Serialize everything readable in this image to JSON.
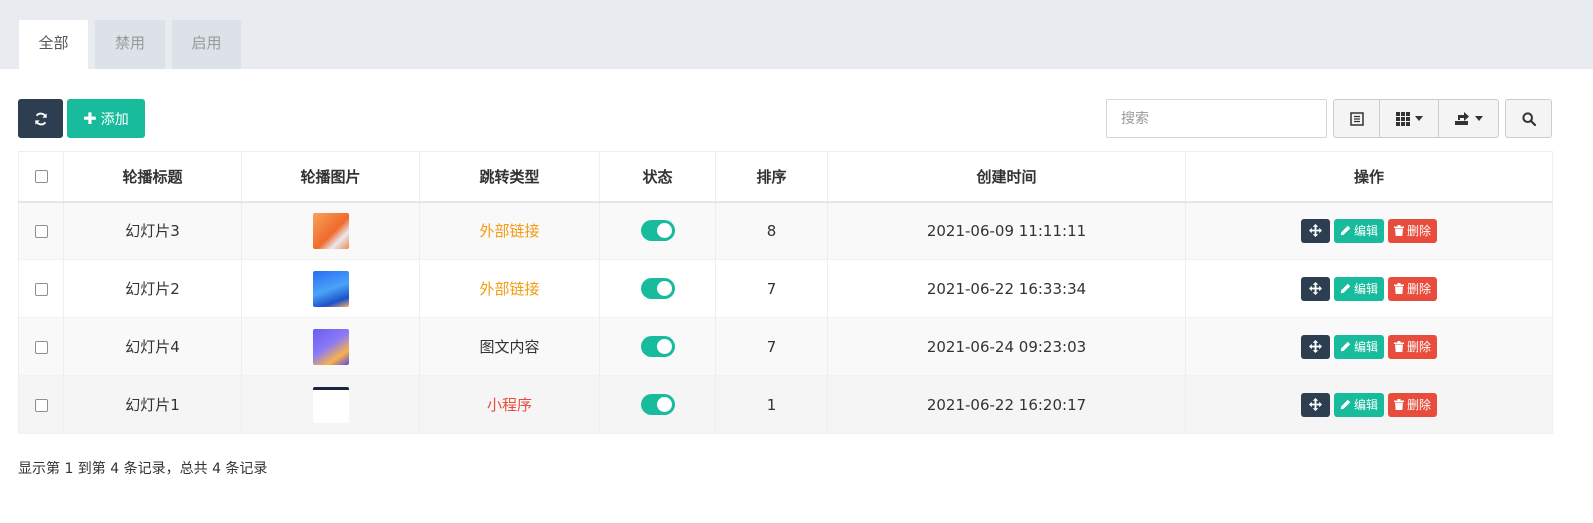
{
  "tabs": [
    {
      "label": "全部",
      "active": true
    },
    {
      "label": "禁用",
      "active": false
    },
    {
      "label": "启用",
      "active": false
    }
  ],
  "toolbar": {
    "refresh_icon": "refresh-icon",
    "add_label": "添加",
    "search_placeholder": "搜索"
  },
  "table": {
    "headers": [
      "轮播标题",
      "轮播图片",
      "跳转类型",
      "状态",
      "排序",
      "创建时间",
      "操作"
    ],
    "rows": [
      {
        "title": "幻灯片3",
        "type": "外部链接",
        "type_color": "#f39c12",
        "status_on": true,
        "sort": "8",
        "created": "2021-06-09 11:11:11"
      },
      {
        "title": "幻灯片2",
        "type": "外部链接",
        "type_color": "#f39c12",
        "status_on": true,
        "sort": "7",
        "created": "2021-06-22 16:33:34"
      },
      {
        "title": "幻灯片4",
        "type": "图文内容",
        "type_color": "#333333",
        "status_on": true,
        "sort": "7",
        "created": "2021-06-24 09:23:03"
      },
      {
        "title": "幻灯片1",
        "type": "小程序",
        "type_color": "#e74c3c",
        "status_on": true,
        "sort": "1",
        "created": "2021-06-22 16:20:17"
      }
    ],
    "ops": {
      "edit_label": "编辑",
      "delete_label": "删除"
    }
  },
  "footer": {
    "text": "显示第 1 到第 4 条记录，总共 4 条记录"
  },
  "colors": {
    "primary": "#2c3e50",
    "success": "#18bc9c",
    "danger": "#e74c3c",
    "warning": "#f39c12"
  }
}
